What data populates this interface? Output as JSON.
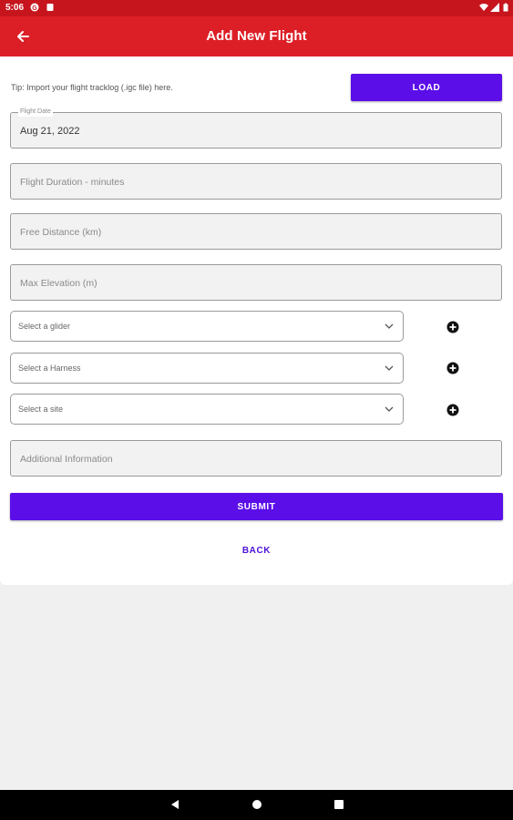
{
  "status_bar": {
    "time": "5:06"
  },
  "app_bar": {
    "title": "Add New Flight"
  },
  "import": {
    "tip": "Tip: Import your flight tracklog (.igc file) here.",
    "load_label": "LOAD"
  },
  "form": {
    "flight_date": {
      "label": "Flight Date",
      "value": "Aug 21, 2022"
    },
    "duration": {
      "placeholder": "Flight Duration - minutes"
    },
    "free_distance": {
      "placeholder": "Free Distance (km)"
    },
    "max_elevation": {
      "placeholder": "Max Elevation (m)"
    },
    "glider": {
      "placeholder": "Select a glider"
    },
    "harness": {
      "placeholder": "Select a Harness"
    },
    "site": {
      "placeholder": "Select a site"
    },
    "additional_info": {
      "placeholder": "Additional Information"
    },
    "submit_label": "SUBMIT",
    "back_label": "BACK"
  },
  "colors": {
    "app_bar": "#dc1f26",
    "status_bar": "#c6151d",
    "primary": "#5b0ee8"
  },
  "icons": [
    "wifi-icon",
    "signal-icon",
    "battery-icon",
    "back-arrow-icon",
    "chevron-down-icon",
    "add-circle-icon",
    "nav-back-icon",
    "nav-home-icon",
    "nav-recents-icon"
  ]
}
